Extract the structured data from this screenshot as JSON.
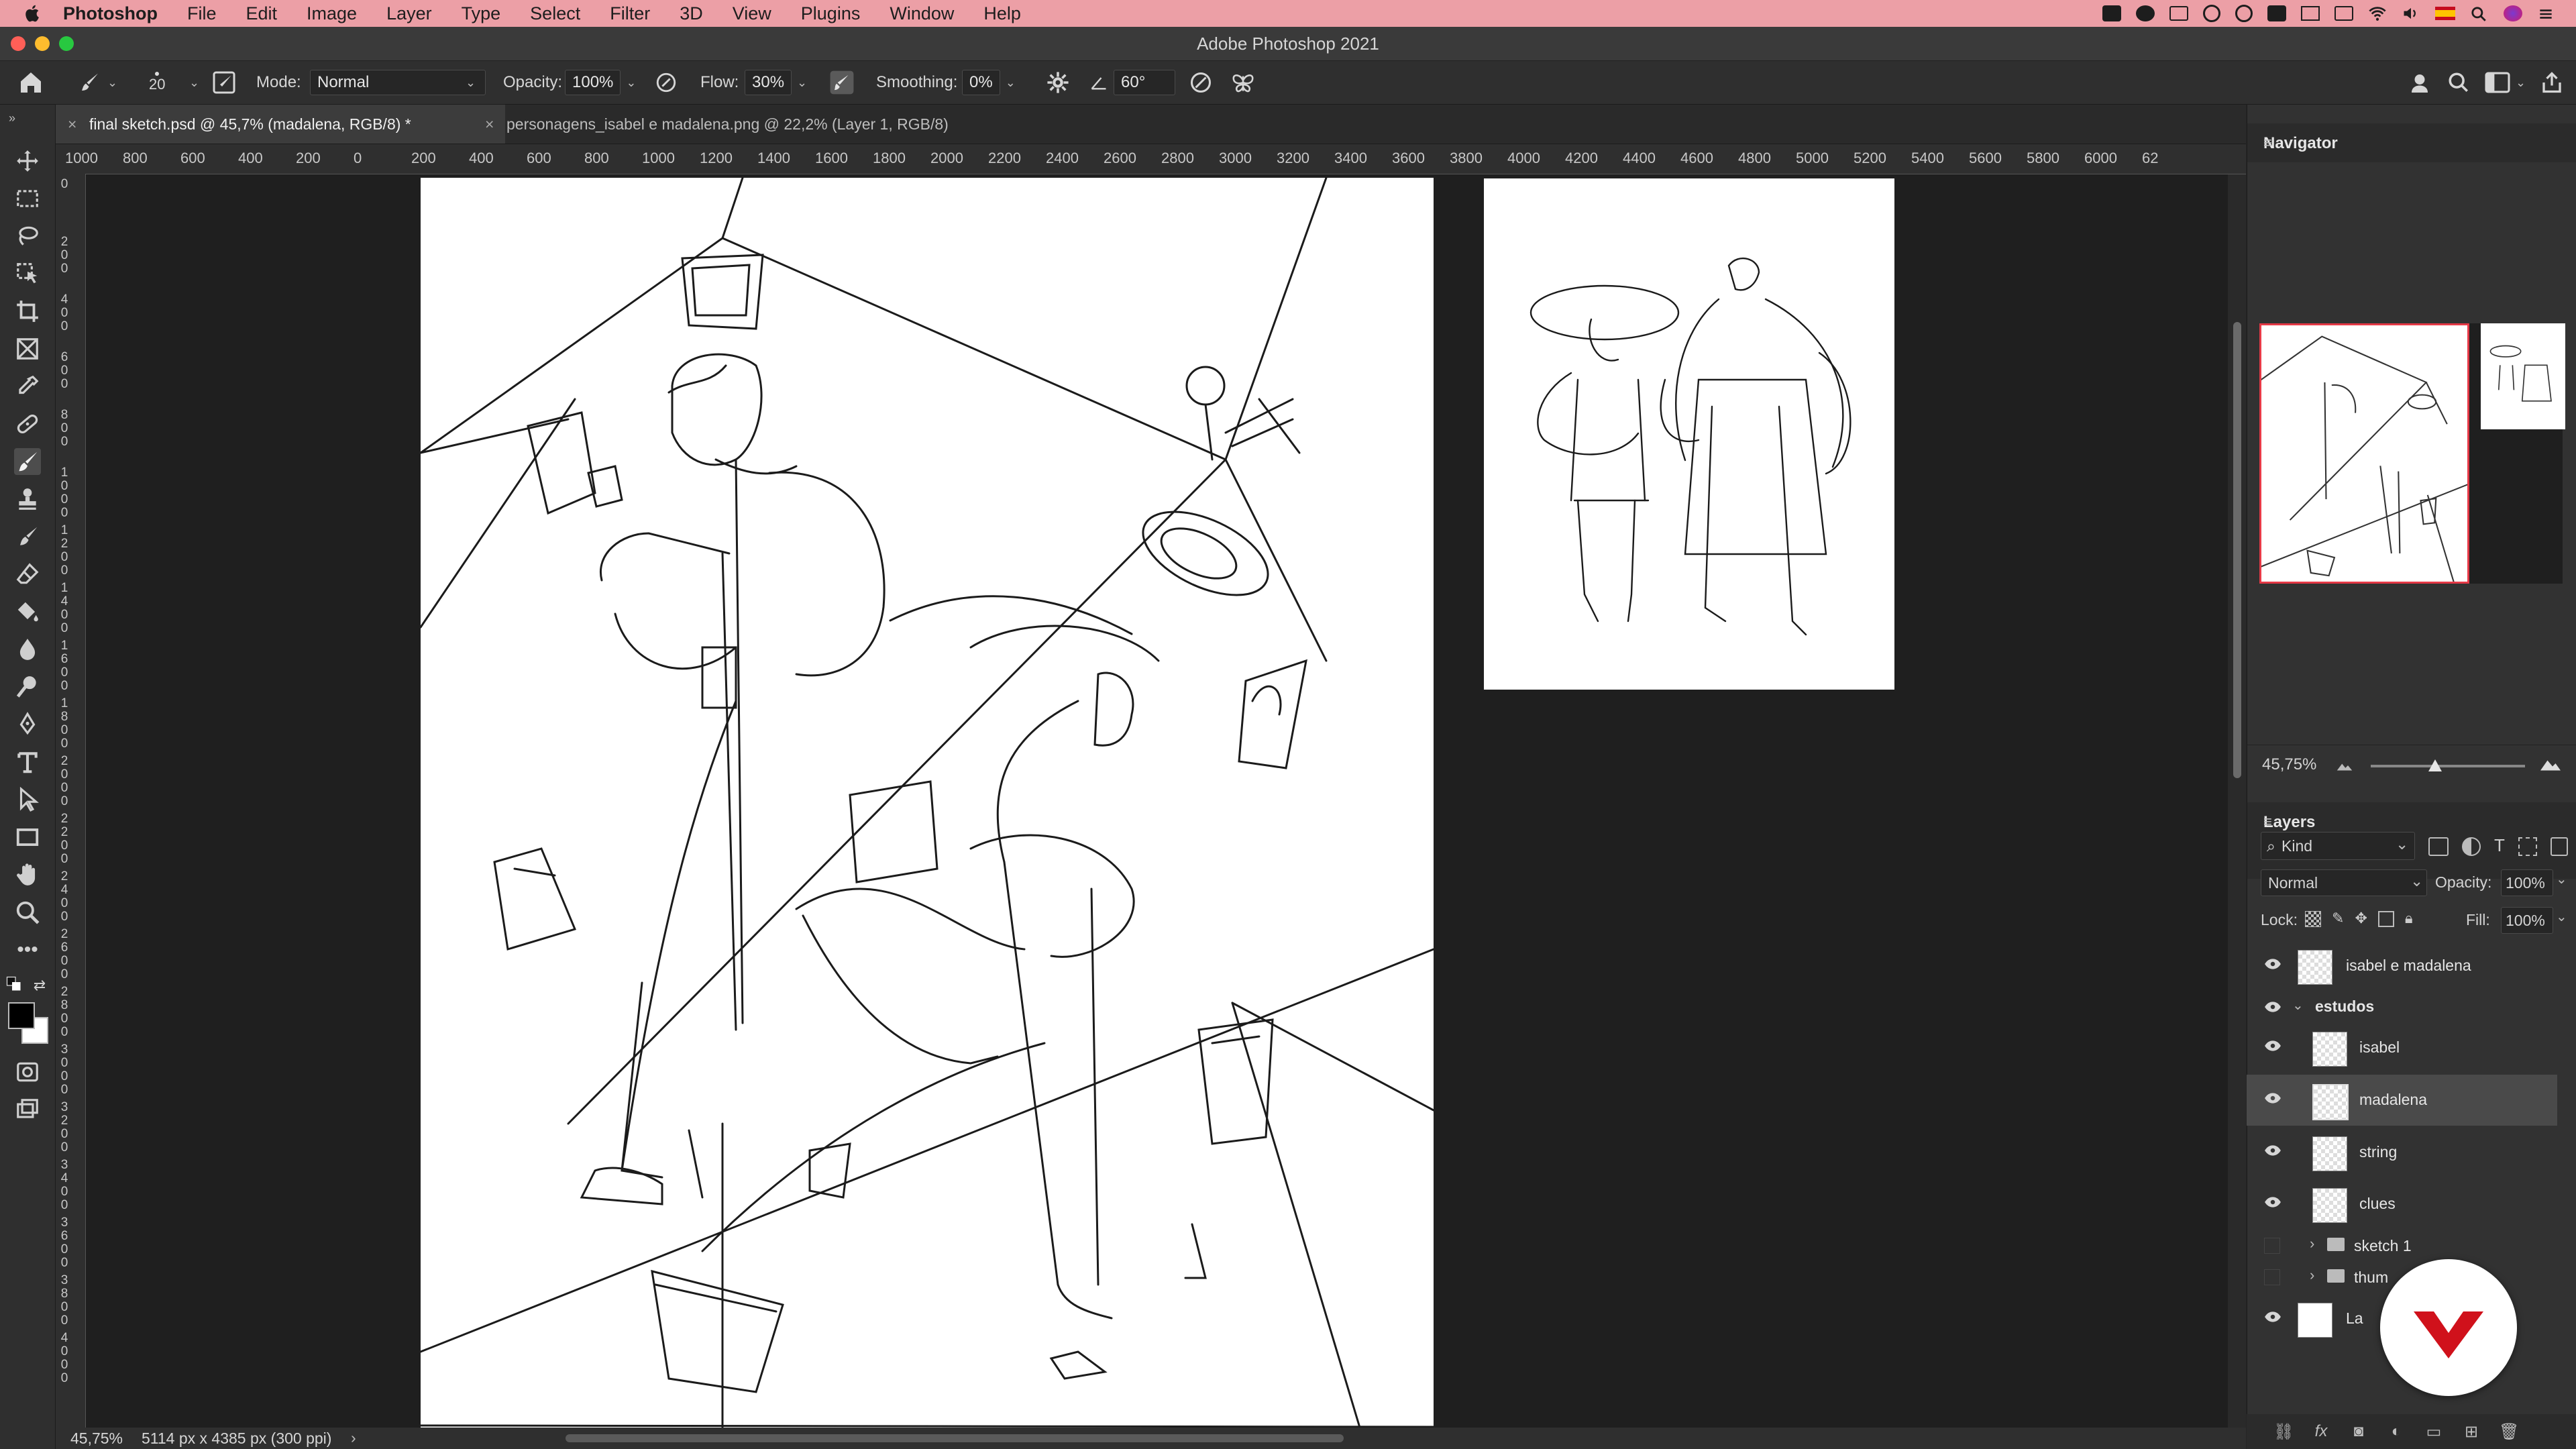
{
  "menubar": {
    "app_name": "Photoshop",
    "items": [
      "File",
      "Edit",
      "Image",
      "Layer",
      "Type",
      "Select",
      "Filter",
      "3D",
      "View",
      "Plugins",
      "Window",
      "Help"
    ]
  },
  "window": {
    "title": "Adobe Photoshop 2021"
  },
  "options_bar": {
    "brush_size": "20",
    "mode_label": "Mode:",
    "mode_value": "Normal",
    "opacity_label": "Opacity:",
    "opacity_value": "100%",
    "flow_label": "Flow:",
    "flow_value": "30%",
    "smoothing_label": "Smoothing:",
    "smoothing_value": "0%",
    "angle_value": "60°"
  },
  "tabs": [
    {
      "label": "final sketch.psd @ 45,7% (madalena, RGB/8) *",
      "active": true,
      "close": "×"
    },
    {
      "label": "personagens_isabel e madalena.png @ 22,2% (Layer 1, RGB/8)",
      "active": false,
      "close": "×"
    }
  ],
  "ruler_h": [
    "1000",
    "800",
    "600",
    "400",
    "200",
    "0",
    "200",
    "400",
    "600",
    "800",
    "1000",
    "1200",
    "1400",
    "1600",
    "1800",
    "2000",
    "2200",
    "2400",
    "2600",
    "2800",
    "3000",
    "3200",
    "3400",
    "3600",
    "3800",
    "4000",
    "4200",
    "4400",
    "4600",
    "4800",
    "5000",
    "5200",
    "5400",
    "5600",
    "5800",
    "6000",
    "62"
  ],
  "ruler_v": [
    "0",
    "200",
    "400",
    "600",
    "800",
    "1000",
    "1200",
    "1400",
    "1600",
    "1800",
    "2000",
    "2200",
    "2400",
    "2600",
    "2800",
    "3000",
    "3200",
    "3400",
    "3600",
    "3800",
    "4000"
  ],
  "status": {
    "zoom": "45,75%",
    "doc_info": "5114 px x 4385 px (300 ppi)",
    "arrow": "›"
  },
  "navigator": {
    "title": "Navigator",
    "zoom": "45,75%"
  },
  "layers_panel": {
    "title": "Layers",
    "filter_label": "Kind",
    "blend_mode": "Normal",
    "opacity_label": "Opacity:",
    "opacity_value": "100%",
    "lock_label": "Lock:",
    "fill_label": "Fill:",
    "fill_value": "100%",
    "layers": [
      {
        "name": "isabel e madalena",
        "visible": true,
        "type": "layer",
        "indent": 0
      },
      {
        "name": "estudos",
        "visible": true,
        "type": "group-open",
        "indent": 0
      },
      {
        "name": "isabel",
        "visible": true,
        "type": "layer",
        "indent": 1
      },
      {
        "name": "madalena",
        "visible": true,
        "type": "layer",
        "indent": 1,
        "selected": true
      },
      {
        "name": "string",
        "visible": true,
        "type": "layer",
        "indent": 1
      },
      {
        "name": "clues",
        "visible": true,
        "type": "layer",
        "indent": 1
      },
      {
        "name": "sketch 1",
        "visible": false,
        "type": "group-closed",
        "indent": 1
      },
      {
        "name": "thum",
        "visible": false,
        "type": "group-closed",
        "indent": 1
      },
      {
        "name": "La",
        "visible": true,
        "type": "layer",
        "indent": 0
      }
    ]
  },
  "colors": {
    "menubar": "#ec9fa6",
    "nav_frame": "#e53946",
    "badge_logo": "#d0111b"
  }
}
